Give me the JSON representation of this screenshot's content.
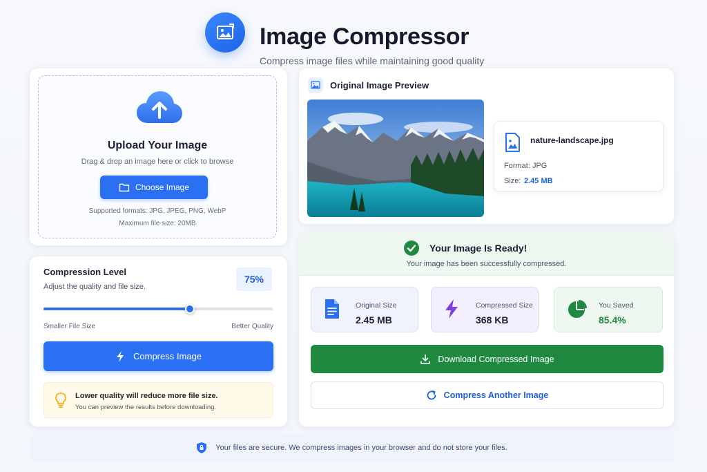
{
  "header": {
    "title": "Image Compressor",
    "subtitle": "Compress image files while maintaining good quality",
    "logo_icon": "image-icon"
  },
  "upload": {
    "title": "Upload Your Image",
    "description": "Drag & drop an image here or click to browse",
    "button_label": "Choose Image",
    "supported_formats": "Supported formats: JPG, JPEG, PNG, WebP",
    "max_size": "Maximum file size: 20MB",
    "icon": "cloud-upload-icon"
  },
  "compression": {
    "title": "Compression Level",
    "description": "Adjust the quality and file size.",
    "level_label": "75%",
    "level_value": 0.64,
    "slider_min_label": "Smaller File Size",
    "slider_max_label": "Better Quality",
    "button_label": "Compress Image",
    "tip_title": "Lower quality will reduce more file size.",
    "tip_description": "You can preview the results before downloading."
  },
  "preview": {
    "title": "Original Image Preview",
    "file_name": "nature-landscape.jpg",
    "format_label": "Format: JPG",
    "size_label": "Size:",
    "size_value": "2.45 MB"
  },
  "result": {
    "title": "Your Image Is Ready!",
    "description": "Your image has been successfully compressed.",
    "stats": [
      {
        "label": "Original Size",
        "value": "2.45 MB",
        "icon": "document-icon"
      },
      {
        "label": "Compressed Size",
        "value": "368 KB",
        "icon": "lightning-icon"
      },
      {
        "label": "You Saved",
        "value": "85.4%",
        "icon": "pie-chart-icon",
        "fraction": 0.854
      }
    ],
    "download_label": "Download Compressed Image",
    "another_label": "Compress Another Image"
  },
  "footer": {
    "text": "Your files are secure. We compress images in your browser and do not store your files."
  },
  "colors": {
    "primary": "#2b6ff2",
    "success": "#1f8a3f",
    "accent_purple": "#7b3fe4"
  }
}
